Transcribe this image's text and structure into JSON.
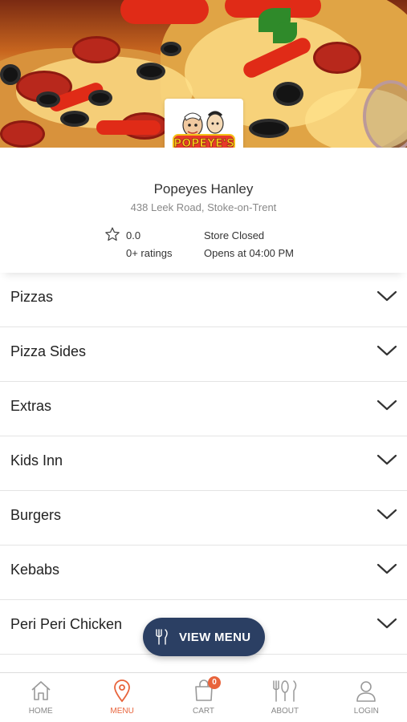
{
  "store": {
    "logo_text": "POPEYE'S",
    "name": "Popeyes Hanley",
    "address": "438 Leek Road, Stoke-on-Trent",
    "rating": "0.0",
    "rating_count": "0+ ratings",
    "status": "Store Closed",
    "opens": "Opens at 04:00 PM"
  },
  "menu": {
    "categories": [
      "Pizzas",
      "Pizza Sides",
      "Extras",
      "Kids Inn",
      "Burgers",
      "Kebabs",
      "Peri Peri Chicken"
    ]
  },
  "view_menu_button": {
    "label": "VIEW MENU",
    "icon": "cutlery-icon"
  },
  "tabbar": {
    "tabs": [
      {
        "label": "HOME",
        "icon": "home-icon"
      },
      {
        "label": "MENU",
        "icon": "map-pin-icon"
      },
      {
        "label": "CART",
        "icon": "shopping-bag-icon"
      },
      {
        "label": "ABOUT",
        "icon": "cutlery-icon"
      },
      {
        "label": "LOGIN",
        "icon": "user-icon"
      }
    ],
    "active_tab": "MENU",
    "cart_count": "0"
  },
  "colors": {
    "accent": "#e8643c",
    "button_bg": "#2b3f63",
    "divider": "#e4e4e4"
  }
}
